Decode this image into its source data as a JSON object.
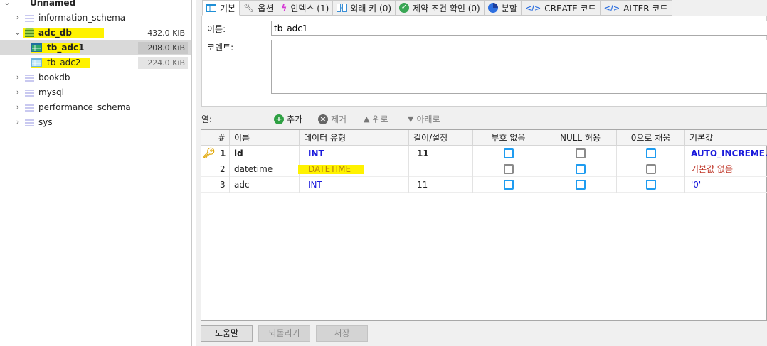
{
  "tree": {
    "root_label": "Unnamed",
    "items": [
      {
        "label": "information_schema",
        "size": ""
      },
      {
        "label": "adc_db",
        "size": "432.0 KiB"
      },
      {
        "label": "tb_adc1",
        "size": "208.0 KiB"
      },
      {
        "label": "tb_adc2",
        "size": "224.0 KiB"
      },
      {
        "label": "bookdb",
        "size": ""
      },
      {
        "label": "mysql",
        "size": ""
      },
      {
        "label": "performance_schema",
        "size": ""
      },
      {
        "label": "sys",
        "size": ""
      }
    ]
  },
  "tabs": [
    {
      "label": "기본",
      "icon": "table-icon"
    },
    {
      "label": "옵션",
      "icon": "wrench-icon"
    },
    {
      "label": "인덱스 (1)",
      "icon": "lightning-icon"
    },
    {
      "label": "외래 키 (0)",
      "icon": "foreign-key-icon"
    },
    {
      "label": "제약 조건 확인 (0)",
      "icon": "check-icon"
    },
    {
      "label": "분할",
      "icon": "pie-icon"
    },
    {
      "label": "CREATE 코드",
      "icon": "code-icon"
    },
    {
      "label": "ALTER 코드",
      "icon": "code-icon"
    }
  ],
  "form": {
    "name_label": "이름:",
    "name_value": "tb_adc1",
    "comment_label": "코멘트:",
    "comment_value": ""
  },
  "columns_toolbar": {
    "label": "열:",
    "add": "추가",
    "remove": "제거",
    "up": "위로",
    "down": "아래로"
  },
  "grid": {
    "headers": [
      "#",
      "이름",
      "데이터 유형",
      "길이/설정",
      "부호 없음",
      "NULL 허용",
      "0으로 채움",
      "기본값"
    ],
    "rows": [
      {
        "num": "1",
        "name": "id",
        "type": "INT",
        "length": "11",
        "unsigned": true,
        "nullable": false,
        "zerofill": true,
        "default": "AUTO_INCREME..."
      },
      {
        "num": "2",
        "name": "datetime",
        "type": "DATETIME",
        "length": "",
        "unsigned": false,
        "nullable": true,
        "zerofill": false,
        "default": "기본값 없음"
      },
      {
        "num": "3",
        "name": "adc",
        "type": "INT",
        "length": "11",
        "unsigned": true,
        "nullable": true,
        "zerofill": true,
        "default": "'0'"
      }
    ]
  },
  "buttons": {
    "help": "도움말",
    "revert": "되돌리기",
    "save": "저장"
  },
  "colors": {
    "highlight": "#fff200",
    "int_type": "#1a1adc",
    "datetime_type": "#b8860b",
    "default_red": "#c0392b",
    "checkbox_blue": "#1f9cf0"
  }
}
